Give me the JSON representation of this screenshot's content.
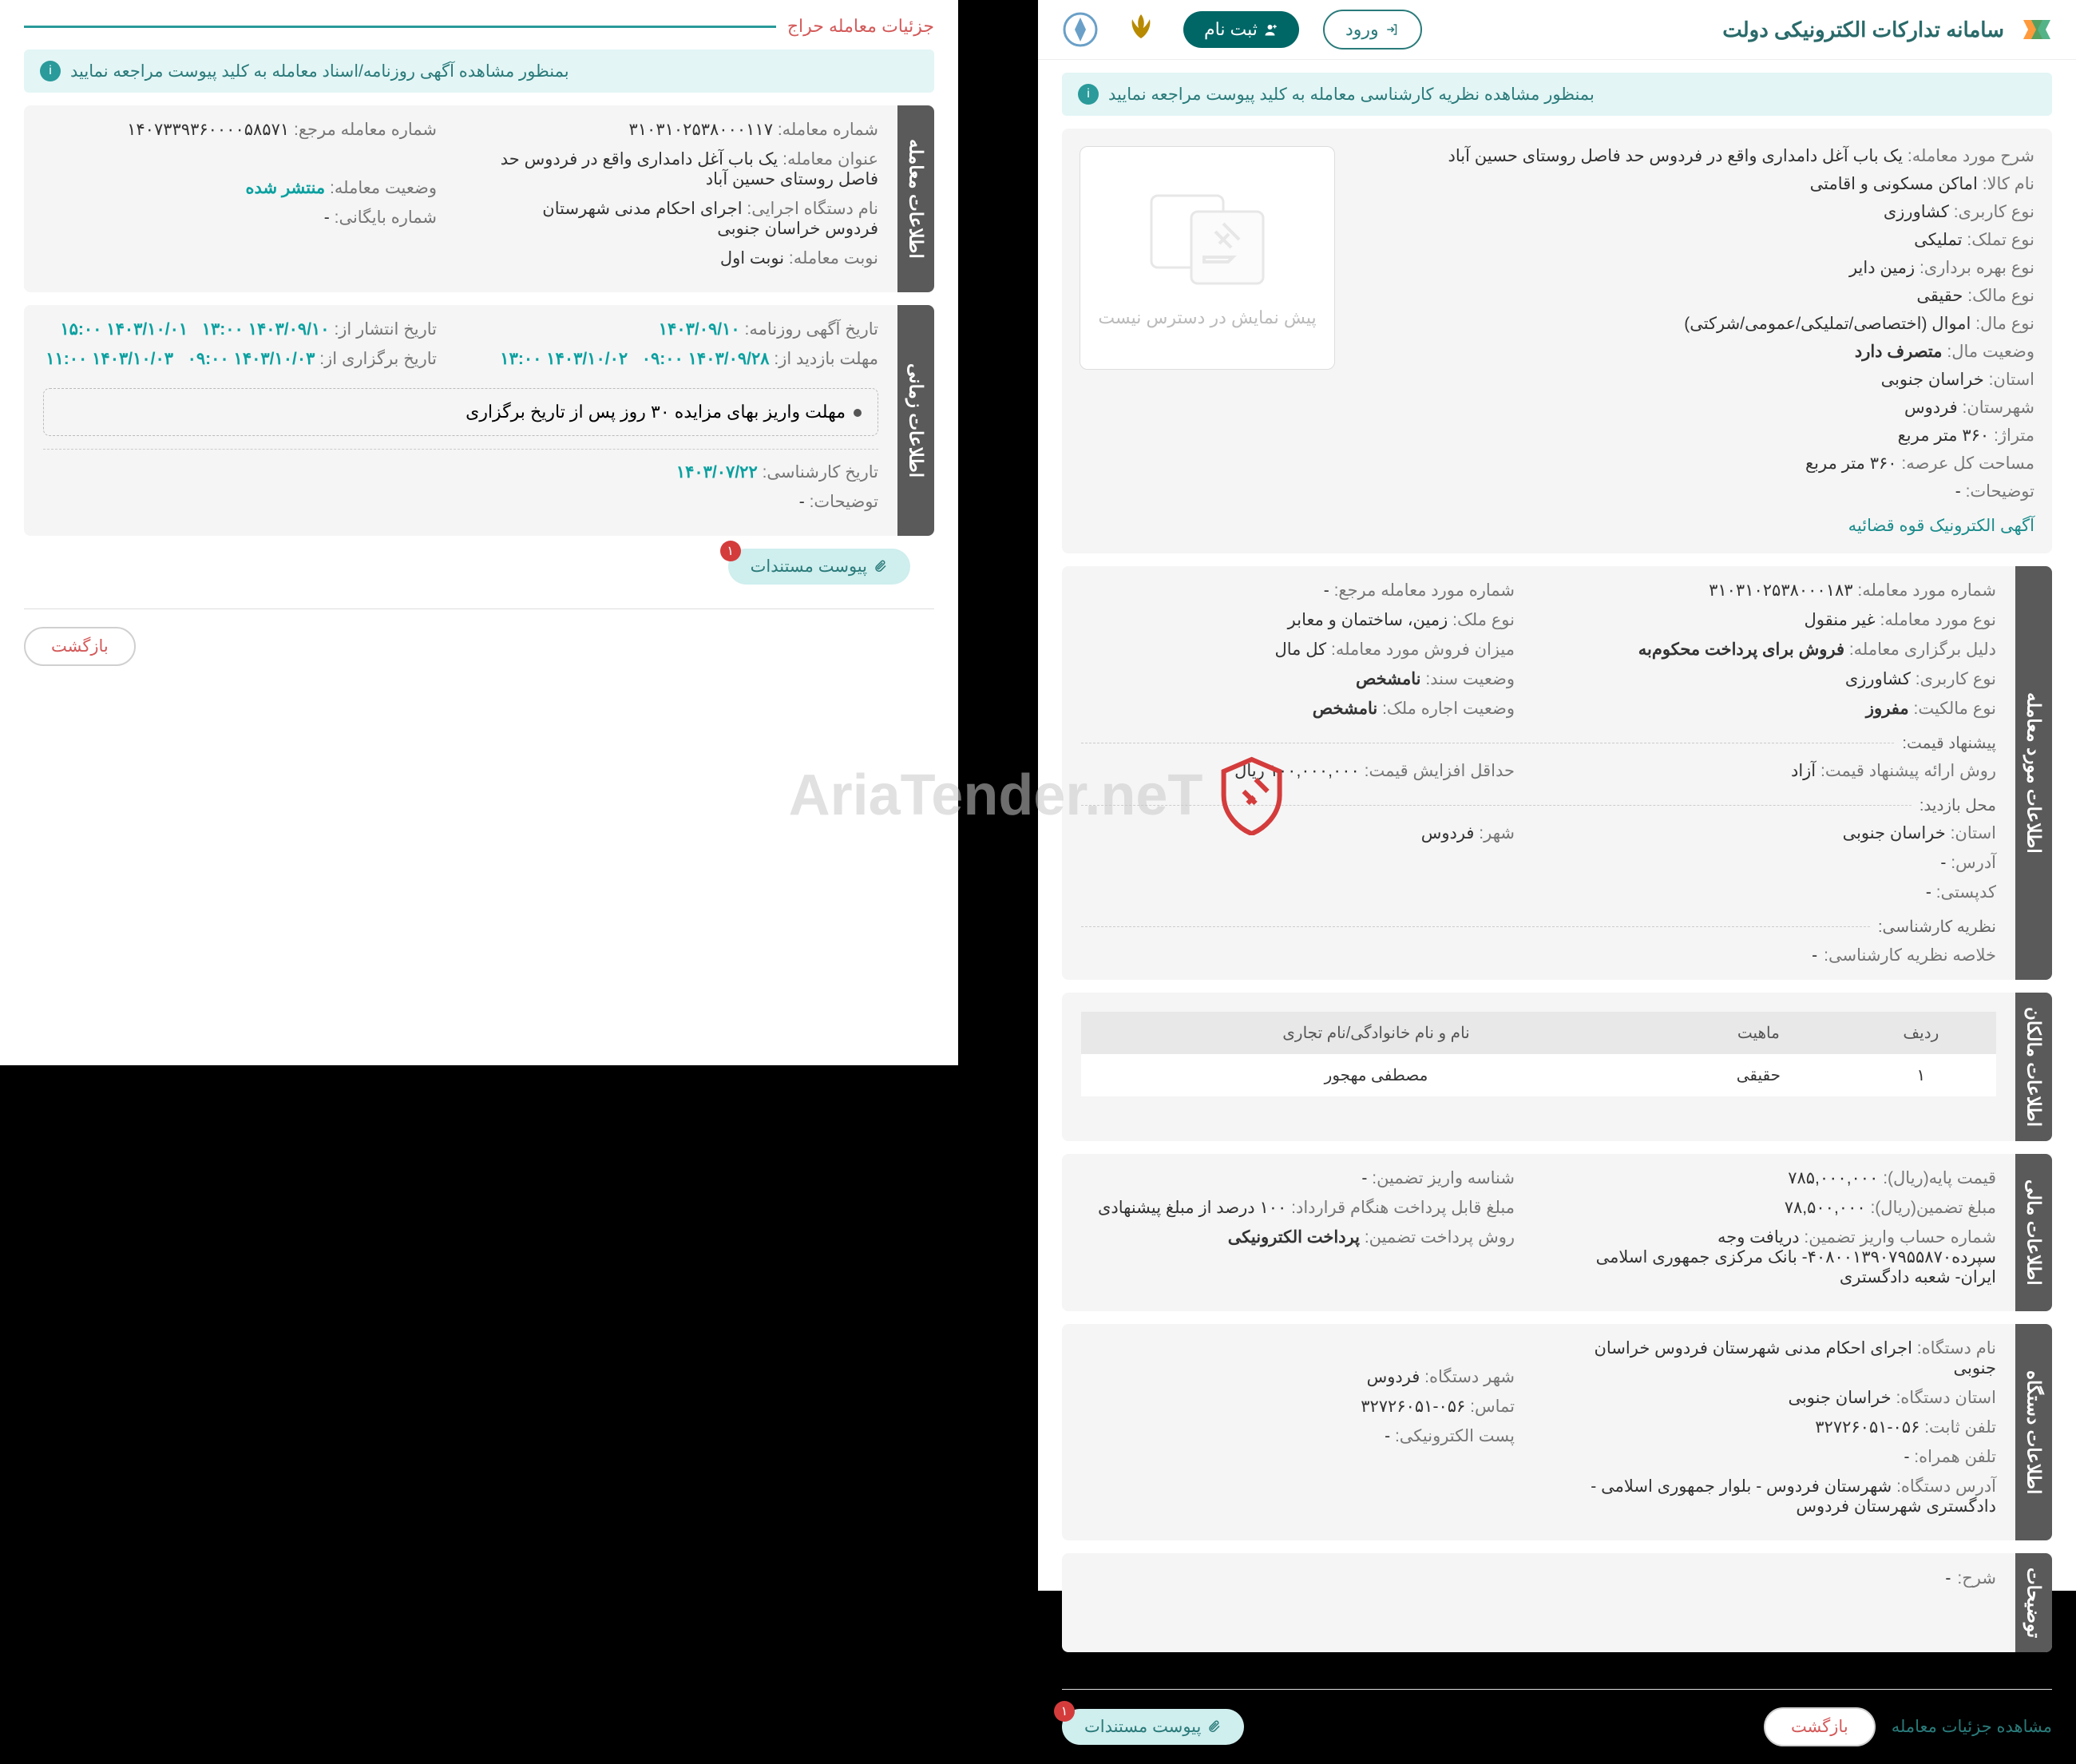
{
  "header": {
    "title": "سامانه تدارکات الکترونیکی دولت",
    "login": "ورود",
    "signup": "ثبت نام"
  },
  "banners": {
    "right": "بمنظور مشاهده نظریه کارشناسی معامله به کلید پیوست مراجعه نمایید",
    "left": "بمنظور مشاهده آگهی روزنامه/اسناد معامله به کلید پیوست مراجعه نمایید"
  },
  "thumb_text": "پیش نمایش در دسترس نیست",
  "top_info": {
    "desc_k": "شرح مورد معامله:",
    "desc_v": "یک باب آغل دامداری واقع در فردوس حد فاصل روستای حسین آباد",
    "goods_k": "نام کالا:",
    "goods_v": "اماکن مسکونی و اقامتی",
    "use_k": "نوع کاربری:",
    "use_v": "کشاورزی",
    "own_k": "نوع تملک:",
    "own_v": "تملیکی",
    "util_k": "نوع بهره برداری:",
    "util_v": "زمین دایر",
    "owner_k": "نوع مالک:",
    "owner_v": "حقیقی",
    "asset_k": "نوع مال:",
    "asset_v": "اموال (اختصاصی/تملیکی/عمومی/شرکتی)",
    "state_k": "وضعیت مال:",
    "state_v": "متصرف دارد",
    "prov_k": "استان:",
    "prov_v": "خراسان جنوبی",
    "city_k": "شهرستان:",
    "city_v": "فردوس",
    "area_k": "متراژ:",
    "area_v": "۳۶۰ متر مربع",
    "land_k": "مساحت کل عرصه:",
    "land_v": "۳۶۰ متر مربع",
    "notes_k": "توضیحات:",
    "notes_v": "-",
    "link": "آگهی الکترونیک قوه قضائیه"
  },
  "tabs": {
    "deal": "اطلاعات مورد معامله",
    "owners": "اطلاعات مالکان",
    "fin": "اطلاعات مالی",
    "org": "اطلاعات دستگاه",
    "notes": "توضیحات",
    "deal_simple": "اطلاعات معامله",
    "time": "اطلاعات زمانی"
  },
  "deal": {
    "dealno_k": "شماره مورد معامله:",
    "dealno_v": "۳۱۰۳۱۰۲۵۳۸۰۰۰۱۸۳",
    "refno_k": "شماره مورد معامله مرجع:",
    "refno_v": "-",
    "dealtype_k": "نوع مورد معامله:",
    "dealtype_v": "غیر منقول",
    "proptype_k": "نوع ملک:",
    "proptype_v": "زمین، ساختمان و معابر",
    "reason_k": "دلیل برگزاری معامله:",
    "reason_v": "فروش برای پرداخت محکوم‌به",
    "sale_k": "میزان فروش مورد معامله:",
    "sale_v": "کل مال",
    "use2_k": "نوع کاربری:",
    "use2_v": "کشاورزی",
    "doc_k": "وضعیت سند:",
    "doc_v": "نامشخص",
    "own2_k": "نوع مالکیت:",
    "own2_v": "مفروز",
    "rent_k": "وضعیت اجاره ملک:",
    "rent_v": "نامشخص",
    "price_sub": "پیشنهاد قیمت:",
    "method_k": "روش ارائه پیشنهاد قیمت:",
    "method_v": "آزاد",
    "min_inc_k": "حداقل افزایش قیمت:",
    "min_inc_v": "۱۰۰,۰۰۰,۰۰۰ ریال",
    "visit_sub": "محل بازدید:",
    "prov2_k": "استان:",
    "prov2_v": "خراسان جنوبی",
    "city2_k": "شهر:",
    "city2_v": "فردوس",
    "addr_k": "آدرس:",
    "addr_v": "-",
    "postal_k": "کدپستی:",
    "postal_v": "-",
    "expert_sub": "نظریه کارشناسی:",
    "expert_k": "خلاصه نظریه کارشناسی:",
    "expert_v": "-"
  },
  "owners": {
    "h_row": "ردیف",
    "h_nature": "ماهیت",
    "h_name": "نام و نام خانوادگی/نام تجاری",
    "r1_row": "۱",
    "r1_nature": "حقیقی",
    "r1_name": "مصطفی مهجور"
  },
  "fin": {
    "base_k": "قیمت پایه(ریال):",
    "base_v": "۷۸۵,۰۰۰,۰۰۰",
    "depid_k": "شناسه واریز تضمین:",
    "depid_v": "-",
    "guar_k": "مبلغ تضمین(ریال):",
    "guar_v": "۷۸,۵۰۰,۰۰۰",
    "pay_k": "مبلغ قابل پرداخت هنگام قرارداد:",
    "pay_v": "۱۰۰ درصد از مبلغ پیشنهادی",
    "acc_k": "شماره حساب واریز تضمین:",
    "acc_v": "دریافت وجه سپرده۴۰۸۰۰۱۳۹۰۷۹۵۵۸۷۰- بانک مرکزی جمهوری اسلامی ایران- شعبه دادگستری",
    "method_k": "روش پرداخت تضمین:",
    "method_v": "پرداخت الکترونیکی"
  },
  "org": {
    "name_k": "نام دستگاه:",
    "name_v": "اجرای احکام مدنی شهرستان فردوس خراسان جنوبی",
    "prov_k": "استان دستگاه:",
    "prov_v": "خراسان جنوبی",
    "city_k": "شهر دستگاه:",
    "city_v": "فردوس",
    "tel_k": "تلفن ثابت:",
    "tel_v": "۰۵۶-۳۲۷۲۶۰۵۱",
    "mob_k": "تماس:",
    "mob_v": "۰۵۶-۳۲۷۲۶۰۵۱",
    "mob2_k": "تلفن همراه:",
    "mob2_v": "-",
    "email_k": "پست الکترونیکی:",
    "email_v": "-",
    "addr_k": "آدرس دستگاه:",
    "addr_v": "شهرستان فردوس - بلوار جمهوری اسلامی - دادگستری شهرستان فردوس"
  },
  "notes": {
    "desc_k": "شرح:",
    "desc_v": "-"
  },
  "footer": {
    "details": "مشاهده جزئیات معامله",
    "back": "بازگشت",
    "attach": "پیوست مستندات",
    "badge": "۱"
  },
  "left_title": "جزئیات معامله حراج",
  "deal_simple": {
    "num_k": "شماره معامله:",
    "num_v": "۳۱۰۳۱۰۲۵۳۸۰۰۰۱۱۷",
    "ref_k": "شماره معامله مرجع:",
    "ref_v": "۱۴۰۷۳۳۹۳۶۰۰۰۰۵۸۵۷۱",
    "title_k": "عنوان معامله:",
    "title_v": "یک باب آغل دامداری واقع در فردوس حد فاصل روستای حسین آباد",
    "org_k": "نام دستگاه اجرایی:",
    "org_v": "اجرای احکام مدنی شهرستان فردوس خراسان جنوبی",
    "status_k": "وضعیت معامله:",
    "status_v": "منتشر شده",
    "turn_k": "نوبت معامله:",
    "turn_v": "نوبت اول",
    "arch_k": "شماره بایگانی:",
    "arch_v": "-"
  },
  "time": {
    "news_k": "تاریخ آگهی روزنامه:",
    "news_v": "۱۴۰۳/۰۹/۱۰",
    "pub_k": "تاریخ انتشار از:",
    "pub_v": "۱۴۰۳/۰۹/۱۰ ۱۳:۰۰",
    "pub_to": "۱۴۰۳/۱۰/۰۱ ۱۵:۰۰",
    "visit_k": "مهلت بازدید از:",
    "visit_v": "۱۴۰۳/۰۹/۲۸ ۰۹:۰۰",
    "visit_to": "۱۴۰۳/۱۰/۰۲ ۱۳:۰۰",
    "hold_k": "تاریخ برگزاری از:",
    "hold_v": "۱۴۰۳/۱۰/۰۳ ۰۹:۰۰",
    "hold_to": "۱۴۰۳/۱۰/۰۳ ۱۱:۰۰",
    "deposit": "مهلت واریز بهای مزایده ۳۰ روز پس از تاریخ برگزاری",
    "expert_k": "تاریخ کارشناسی:",
    "expert_v": "۱۴۰۳/۰۷/۲۲",
    "notes_k": "توضیحات:",
    "notes_v": "-"
  },
  "watermark": "AriaTender.neT"
}
